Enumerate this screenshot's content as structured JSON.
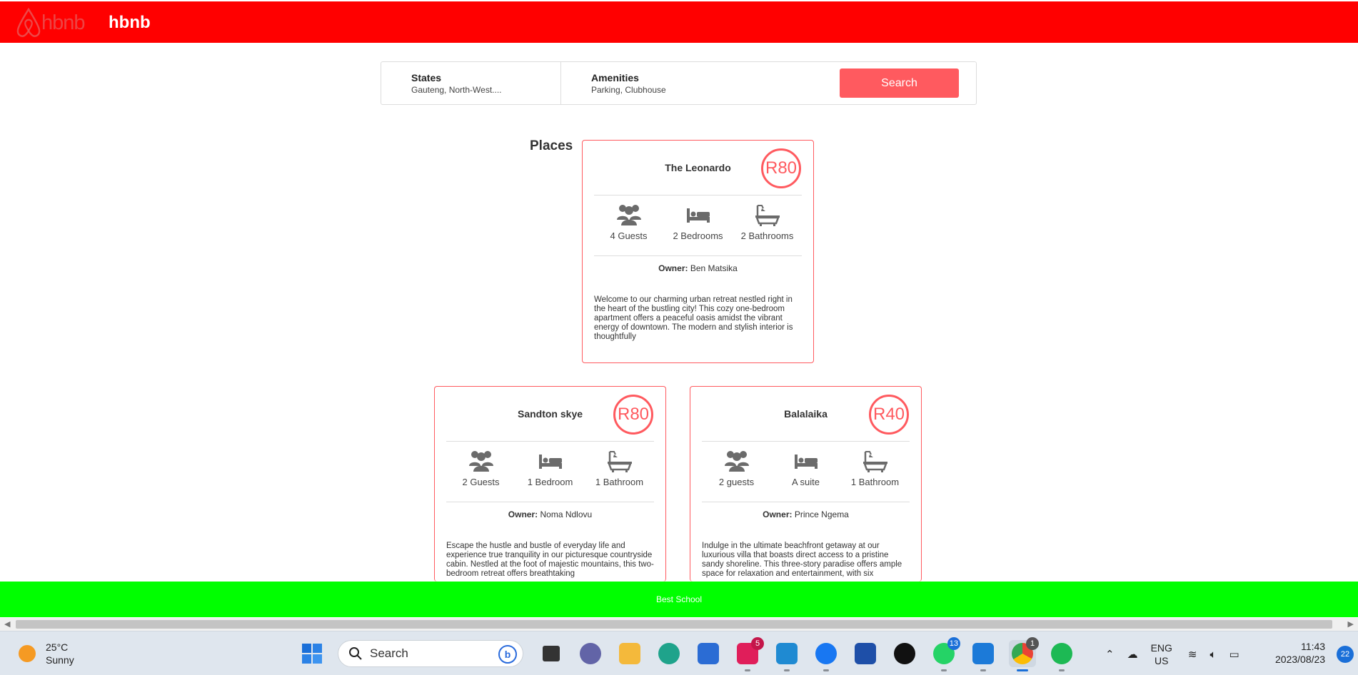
{
  "header": {
    "logo_text": "hbnb",
    "brand": "hbnb",
    "colors": {
      "background": "#ff0000"
    }
  },
  "filters": {
    "states": {
      "title": "States",
      "value": "Gauteng, North-West...."
    },
    "amenities": {
      "title": "Amenities",
      "value": "Parking, Clubhouse"
    },
    "search_label": "Search"
  },
  "places_title": "Places",
  "places": [
    {
      "name": "The Leonardo",
      "price": "R80",
      "guests": "4 Guests",
      "bedrooms": "2 Bedrooms",
      "bathrooms": "2 Bathrooms",
      "owner_label": "Owner:",
      "owner": "Ben Matsika",
      "description": "Welcome to our charming urban retreat nestled right in the heart of the bustling city! This cozy one-bedroom apartment offers a peaceful oasis amidst the vibrant energy of downtown. The modern and stylish interior is thoughtfully"
    },
    {
      "name": "Sandton skye",
      "price": "R80",
      "guests": "2 Guests",
      "bedrooms": "1 Bedroom",
      "bathrooms": "1 Bathroom",
      "owner_label": "Owner:",
      "owner": "Noma Ndlovu",
      "description": "Escape the hustle and bustle of everyday life and experience true tranquility in our picturesque countryside cabin. Nestled at the foot of majestic mountains, this two-bedroom retreat offers breathtaking"
    },
    {
      "name": "Balalaika",
      "price": "R40",
      "guests": "2 guests",
      "bedrooms": "A suite",
      "bathrooms": "1 Bathroom",
      "owner_label": "Owner:",
      "owner": "Prince Ngema",
      "description": "Indulge in the ultimate beachfront getaway at our luxurious villa that boasts direct access to a pristine sandy shoreline. This three-story paradise offers ample space for relaxation and entertainment, with six"
    }
  ],
  "footer": {
    "text": "Best School",
    "color": "#00ff00"
  },
  "taskbar": {
    "weather_temp": "25°C",
    "weather_desc": "Sunny",
    "search_label": "Search",
    "badges": {
      "slack": "5",
      "whatsapp": "13",
      "chrome": "1"
    },
    "lang_1": "ENG",
    "lang_2": "US",
    "time": "11:43",
    "date": "2023/08/23",
    "notifications": "22"
  }
}
